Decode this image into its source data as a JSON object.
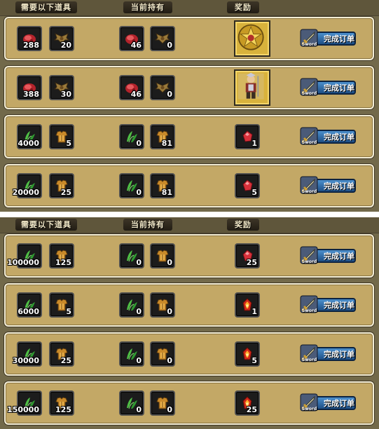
{
  "panels": [
    {
      "headers": {
        "required": "需要以下道具",
        "held": "当前持有",
        "reward": "奖励"
      },
      "rows": [
        {
          "req": [
            {
              "icon": "meat-icon",
              "count": "288"
            },
            {
              "icon": "bat-wings-icon",
              "count": "20"
            }
          ],
          "have": [
            {
              "icon": "meat-icon",
              "count": "46"
            },
            {
              "icon": "bat-wings-icon",
              "count": "0"
            }
          ],
          "reward": {
            "type": "picture",
            "icon": "star-badge-icon",
            "count": ""
          },
          "button": "完成订单",
          "button_sub": "Sword"
        },
        {
          "req": [
            {
              "icon": "meat-icon",
              "count": "388"
            },
            {
              "icon": "bat-wings-icon",
              "count": "30"
            }
          ],
          "have": [
            {
              "icon": "meat-icon",
              "count": "46"
            },
            {
              "icon": "bat-wings-icon",
              "count": "0"
            }
          ],
          "reward": {
            "type": "picture",
            "icon": "warrior-portrait-icon",
            "count": ""
          },
          "button": "完成订单",
          "button_sub": "Sword"
        },
        {
          "req": [
            {
              "icon": "herb-icon",
              "count": "4000"
            },
            {
              "icon": "armor-icon",
              "count": "5"
            }
          ],
          "have": [
            {
              "icon": "herb-icon",
              "count": "0"
            },
            {
              "icon": "armor-icon",
              "count": "81"
            }
          ],
          "reward": {
            "type": "slot",
            "icon": "red-gem-icon",
            "count": "1"
          },
          "button": "完成订单",
          "button_sub": "Sword"
        },
        {
          "req": [
            {
              "icon": "herb-icon",
              "count": "20000"
            },
            {
              "icon": "armor-icon",
              "count": "25"
            }
          ],
          "have": [
            {
              "icon": "herb-icon",
              "count": "0"
            },
            {
              "icon": "armor-icon",
              "count": "81"
            }
          ],
          "reward": {
            "type": "slot",
            "icon": "red-gem-icon",
            "count": "5"
          },
          "button": "完成订单",
          "button_sub": "Sword"
        }
      ]
    },
    {
      "headers": {
        "required": "需要以下道具",
        "held": "当前持有",
        "reward": "奖励"
      },
      "rows": [
        {
          "req": [
            {
              "icon": "herb-icon",
              "count": "100000"
            },
            {
              "icon": "armor-icon",
              "count": "125"
            }
          ],
          "have": [
            {
              "icon": "herb-icon",
              "count": "0"
            },
            {
              "icon": "armor-icon",
              "count": "0"
            }
          ],
          "reward": {
            "type": "slot",
            "icon": "red-gem-icon",
            "count": "25"
          },
          "button": "完成订单",
          "button_sub": "Sword"
        },
        {
          "req": [
            {
              "icon": "herb-icon",
              "count": "6000"
            },
            {
              "icon": "armor-icon",
              "count": "5"
            }
          ],
          "have": [
            {
              "icon": "herb-icon",
              "count": "0"
            },
            {
              "icon": "armor-icon",
              "count": "0"
            }
          ],
          "reward": {
            "type": "slot",
            "icon": "fire-crystal-icon",
            "count": "1"
          },
          "button": "完成订单",
          "button_sub": "Sword"
        },
        {
          "req": [
            {
              "icon": "herb-icon",
              "count": "30000"
            },
            {
              "icon": "armor-icon",
              "count": "25"
            }
          ],
          "have": [
            {
              "icon": "herb-icon",
              "count": "0"
            },
            {
              "icon": "armor-icon",
              "count": "0"
            }
          ],
          "reward": {
            "type": "slot",
            "icon": "fire-crystal-icon",
            "count": "5"
          },
          "button": "完成订单",
          "button_sub": "Sword"
        },
        {
          "req": [
            {
              "icon": "herb-icon",
              "count": "150000"
            },
            {
              "icon": "armor-icon",
              "count": "125"
            }
          ],
          "have": [
            {
              "icon": "herb-icon",
              "count": "0"
            },
            {
              "icon": "armor-icon",
              "count": "0"
            }
          ],
          "reward": {
            "type": "slot",
            "icon": "fire-crystal-icon",
            "count": "25"
          },
          "button": "完成订单",
          "button_sub": "Sword"
        }
      ]
    }
  ]
}
